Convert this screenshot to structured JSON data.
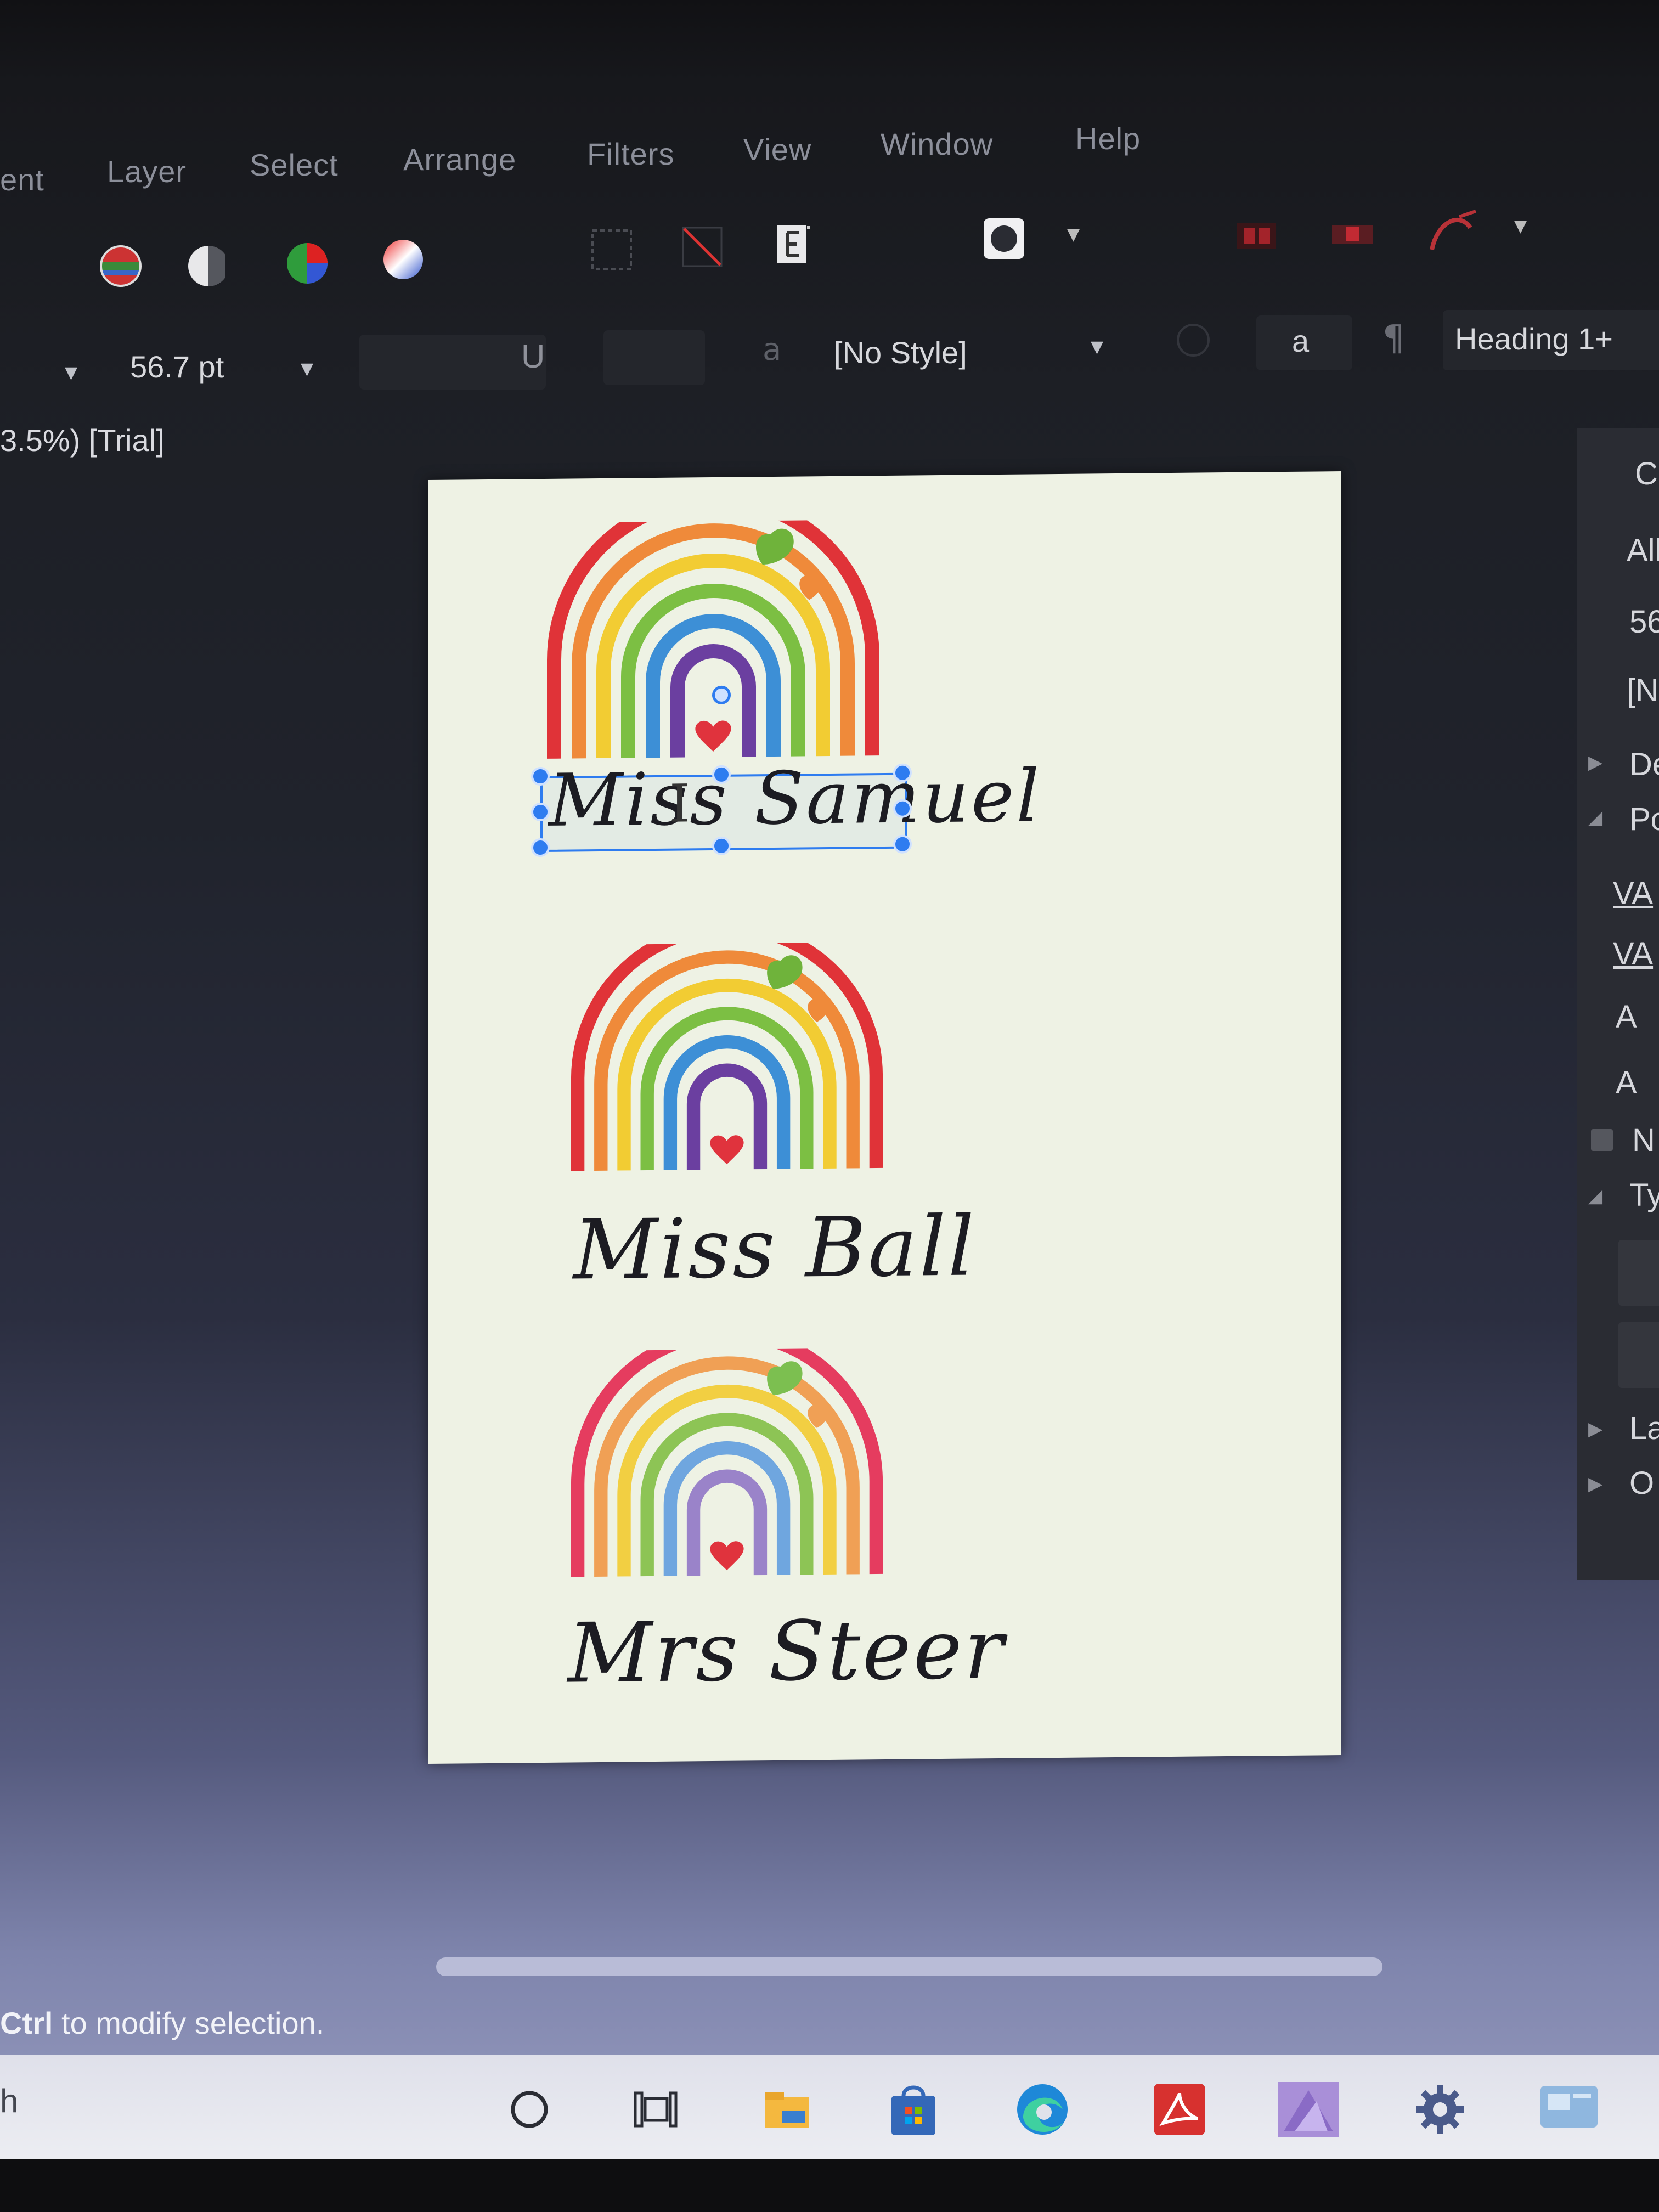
{
  "menu": [
    "ent",
    "Layer",
    "Select",
    "Arrange",
    "Filters",
    "View",
    "Window",
    "Help"
  ],
  "context": {
    "font_size": "56.7 pt",
    "underline": "U",
    "style": "[No Style]",
    "para_style": "Heading 1+",
    "char_a": "a",
    "para_glyph": "¶"
  },
  "document_title": "3.5%) [Trial]",
  "right_panel": {
    "labels": [
      "C",
      "All",
      "56",
      "[N",
      "De",
      "Po",
      "VA",
      "VA",
      "A",
      "A",
      "N",
      "Ty",
      "La",
      "O"
    ]
  },
  "canvas": {
    "names": [
      "Miss Samuel",
      "Miss Ball",
      "Mrs Steer"
    ],
    "text_cursor": "I"
  },
  "status": {
    "key": "Ctrl",
    "message": " to modify selection."
  },
  "taskbar": {
    "search_stub": "h",
    "icons": [
      "cortana-circle-icon",
      "task-view-icon",
      "file-explorer-icon",
      "store-icon",
      "edge-icon",
      "acrobat-icon",
      "affinity-icon",
      "settings-icon",
      "app-icon"
    ]
  },
  "colors": {
    "selection": "#2e7cf0",
    "page": "#eef2e4",
    "rainbow": [
      "#e03338",
      "#ef8a3a",
      "#f2cc33",
      "#7cbf43",
      "#3d8fd6",
      "#6b3fa0"
    ],
    "heart": "#e0333d",
    "leaf_green": "#6fb33b",
    "leaf_orange": "#ef8a3a"
  }
}
